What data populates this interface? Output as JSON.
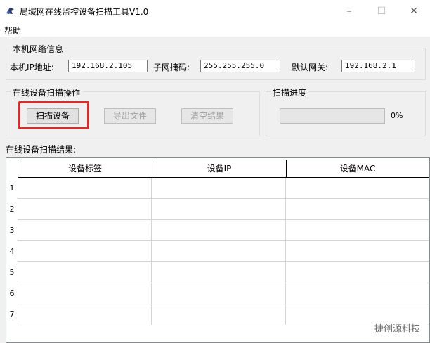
{
  "window": {
    "title": "局域网在线监控设备扫描工具V1.0",
    "icon": "app-icon",
    "controls": {
      "minimize": "–",
      "maximize": "☐",
      "close": "✕"
    }
  },
  "menu": {
    "help": "帮助"
  },
  "local_info": {
    "legend": "本机网络信息",
    "ip_label": "本机IP地址:",
    "ip_value": "192.168.2.105",
    "mask_label": "子网掩码:",
    "mask_value": "255.255.255.0",
    "gateway_label": "默认网关:",
    "gateway_value": "192.168.2.1"
  },
  "scan_ops": {
    "legend": "在线设备扫描操作",
    "scan_button": "扫描设备",
    "export_button": "导出文件",
    "clear_button": "清空结果"
  },
  "progress": {
    "legend": "扫描进度",
    "percent_text": "0%",
    "value": 0
  },
  "results": {
    "label": "在线设备扫描结果:",
    "columns": [
      "设备标签",
      "设备IP",
      "设备MAC"
    ],
    "row_numbers": [
      "1",
      "2",
      "3",
      "4",
      "5",
      "6",
      "7"
    ]
  },
  "watermark": "捷创源科技",
  "colors": {
    "highlight": "#d32f2f",
    "titlebar": "#ffffff"
  }
}
